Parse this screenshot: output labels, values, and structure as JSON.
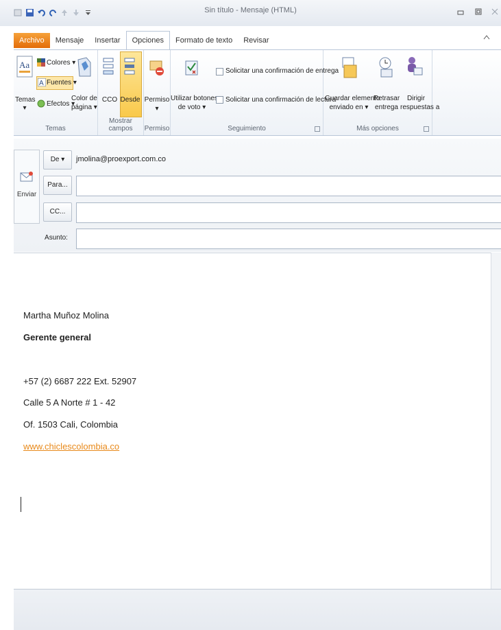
{
  "window": {
    "title": "Sin título - Mensaje (HTML)"
  },
  "tabs": [
    {
      "label": "Archivo"
    },
    {
      "label": "Mensaje"
    },
    {
      "label": "Insertar"
    },
    {
      "label": "Opciones"
    },
    {
      "label": "Formato de texto"
    },
    {
      "label": "Revisar"
    }
  ],
  "ribbon": {
    "temas": {
      "temas_line1": "Temas",
      "temas_line2": "▾",
      "colores": "Colores ▾",
      "fuentes": "Fuentes ▾",
      "efectos": "Efectos ▾",
      "color_pagina_line1": "Color de",
      "color_pagina_line2": "página ▾",
      "group": "Temas"
    },
    "mostrar": {
      "cco": "CCO",
      "desde": "Desde",
      "group": "Mostrar campos"
    },
    "permiso": {
      "label": "Permiso",
      "arrow": "▾",
      "group": "Permiso"
    },
    "seguimiento": {
      "votar_line1": "Utilizar botones",
      "votar_line2": "de voto ▾",
      "confirm_entrega": "Solicitar una confirmación de entrega",
      "confirm_lectura": "Solicitar una confirmación de lectura",
      "group": "Seguimiento"
    },
    "mas": {
      "guardar_line1": "Guardar elemento",
      "guardar_line2": "enviado en ▾",
      "retrasar_line1": "Retrasar",
      "retrasar_line2": "entrega",
      "dirigir_line1": "Dirigir",
      "dirigir_line2": "respuestas a",
      "group": "Más opciones"
    }
  },
  "compose": {
    "send": "Enviar",
    "from_button": "De ▾",
    "from_value": "jmolina@proexport.com.co",
    "to_button": "Para...",
    "cc_button": "CC...",
    "subject_label": "Asunto:",
    "to_value": "",
    "cc_value": "",
    "subject_value": ""
  },
  "signature": {
    "name": "Martha Muñoz Molina",
    "role": "Gerente general",
    "phone": "+57 (2) 6687 222 Ext. 52907",
    "address1": "Calle 5 A Norte # 1 - 42",
    "address2": "Of. 1503 Cali, Colombia",
    "website": "www.chiclescolombia.co"
  },
  "colors": {
    "accent": "#e36c0a",
    "link": "#e8891a",
    "selected_button": "#fbd66e"
  }
}
